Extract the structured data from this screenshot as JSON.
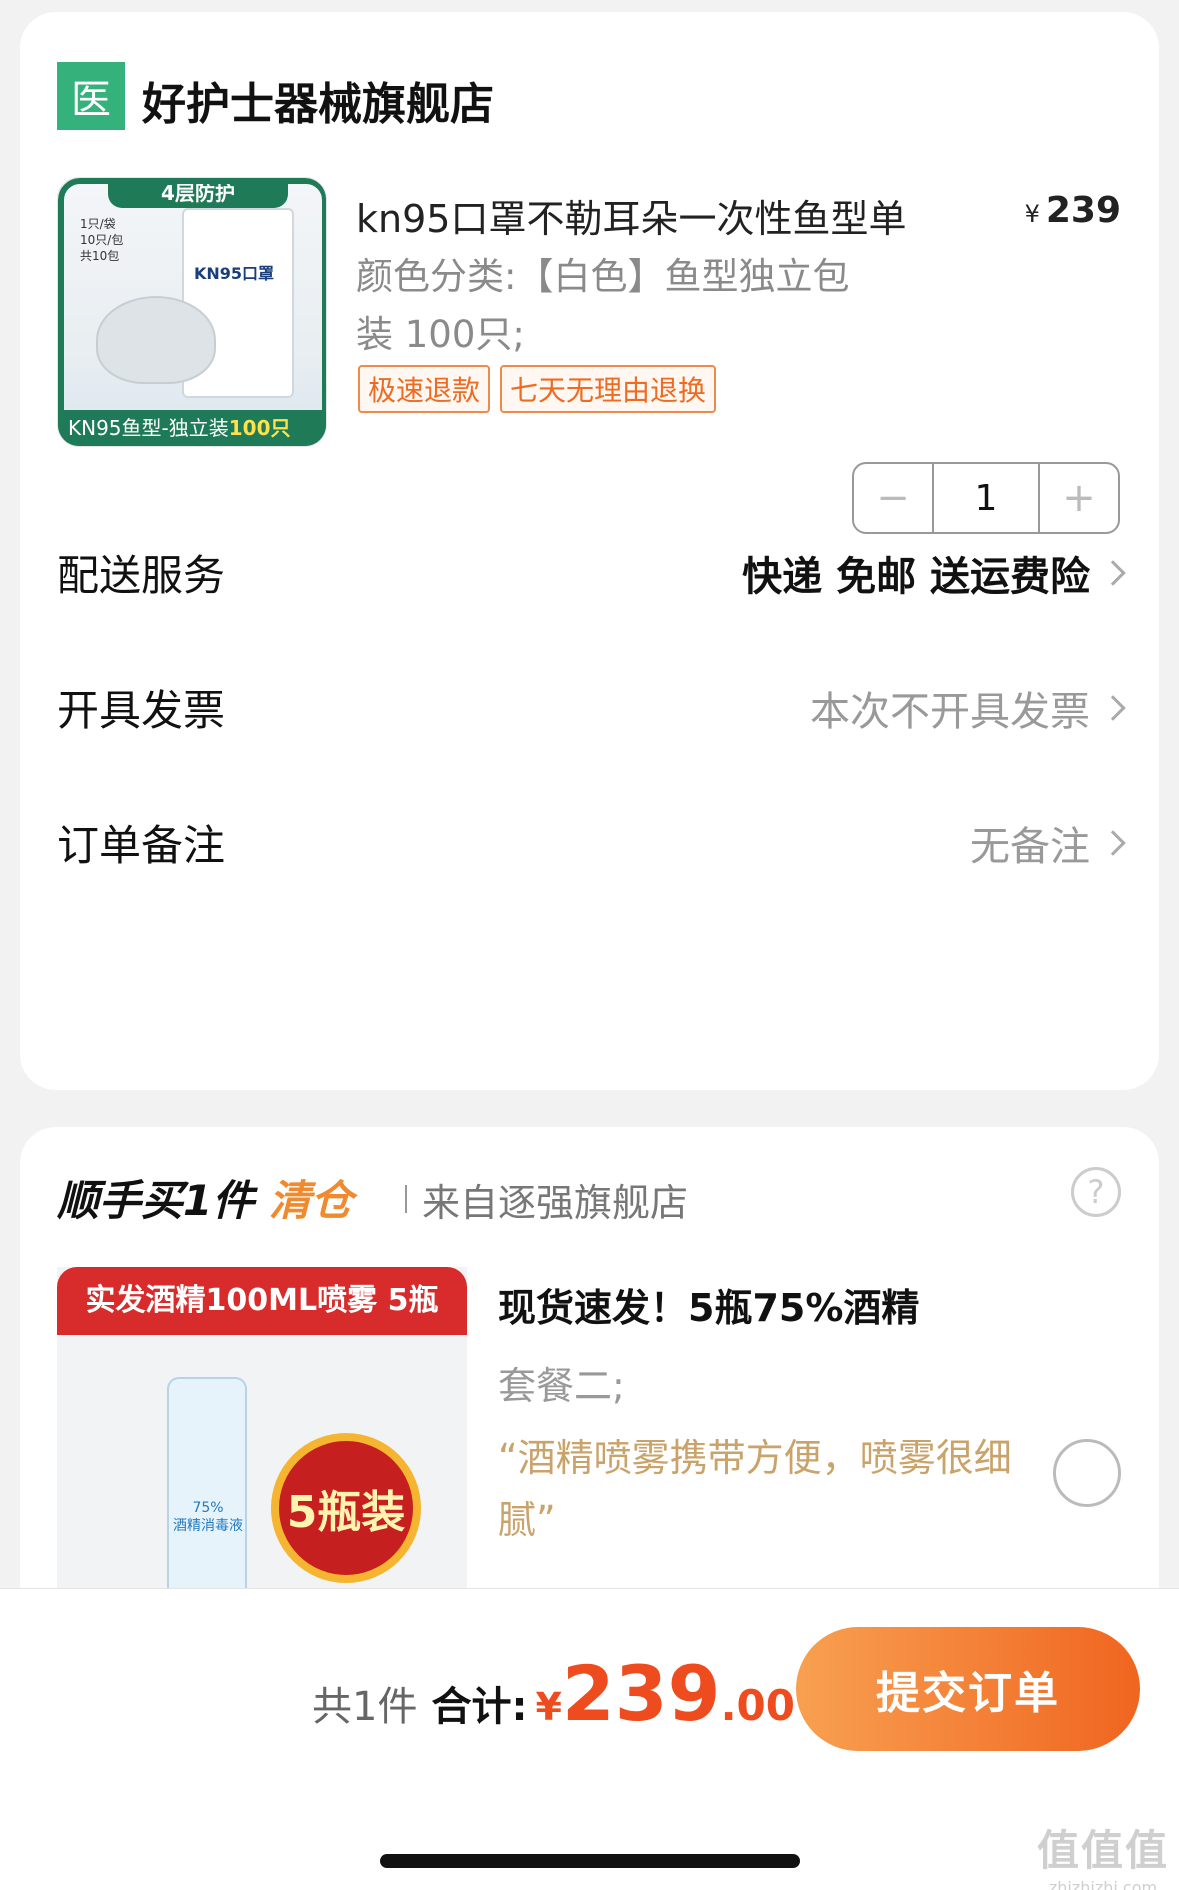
{
  "store": {
    "badge": "医",
    "name": "好护士器械旗舰店",
    "product": {
      "title": "kn95口罩不勒耳朵一次性鱼型单",
      "currency": "¥",
      "price": "239",
      "spec": "颜色分类:【白色】鱼型独立包装 100只;",
      "tags": [
        "极速退款",
        "七天无理由退换"
      ],
      "image": {
        "top_banner": "4层防护",
        "pack_info": "1只/袋\n10只/包\n共10包",
        "pack_brand": "KN95口罩",
        "bottom_banner_prefix": "KN95鱼型-独立装",
        "bottom_banner_highlight": "100只"
      },
      "quantity": "1",
      "minus_symbol": "−",
      "plus_symbol": "+"
    },
    "rows": [
      {
        "label": "配送服务",
        "value": "快递 免邮 送运费险"
      },
      {
        "label": "开具发票",
        "value": "本次不开具发票"
      },
      {
        "label": "订单备注",
        "value": "无备注"
      }
    ]
  },
  "addon": {
    "title_prefix": "顺手买1件",
    "title_highlight": "清仓",
    "source": "来自逐强旗舰店",
    "help_symbol": "?",
    "item": {
      "image_banner": "实发酒精100ML喷雾 5瓶",
      "bottle_label": "75%\n酒精消毒液",
      "badge": "5瓶装",
      "name": "现货速发！5瓶75%酒精",
      "spec": "套餐二;",
      "review": "“酒精喷雾携带方便，喷雾很细腻”"
    }
  },
  "footer": {
    "count": "共1件",
    "total_label": "合计:",
    "currency": "¥",
    "total_int": "239",
    "total_dec": ".00",
    "submit": "提交订单"
  },
  "watermark": {
    "big": "值值值",
    "small": "zhizhizhi.com"
  },
  "colors": {
    "accent": "#ee4c1f",
    "store_badge": "#35b27c",
    "submit_start": "#f8a051",
    "submit_end": "#f06520"
  }
}
